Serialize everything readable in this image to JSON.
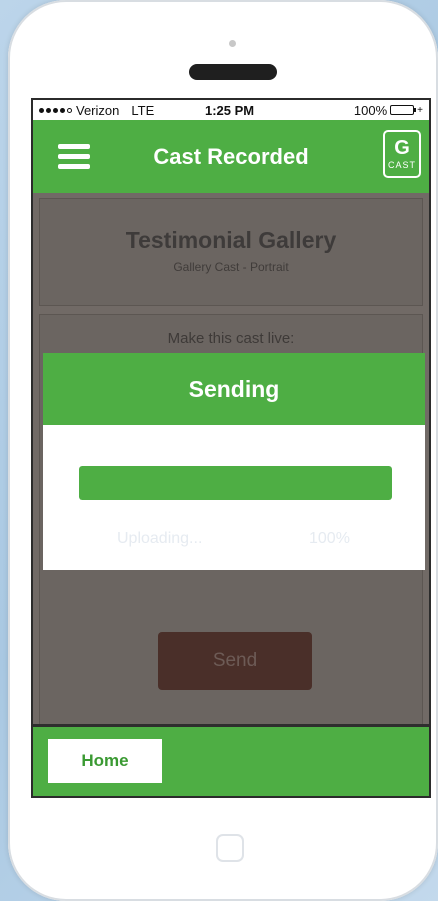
{
  "status_bar": {
    "carrier": "Verizon",
    "network": "LTE",
    "time": "1:25 PM",
    "battery": "100%"
  },
  "nav": {
    "title": "Cast Recorded",
    "logo_text": "CAST"
  },
  "gallery": {
    "title": "Testimonial Gallery",
    "subtitle": "Gallery Cast - Portrait",
    "prompt": "Make this cast live:"
  },
  "send_button": "Send",
  "modal": {
    "title": "Sending",
    "status_label": "Uploading...",
    "percent_text": "100%",
    "progress": 1.0
  },
  "footer": {
    "home_label": "Home"
  },
  "colors": {
    "accent": "#4eae44",
    "overlay": "#6b6561",
    "send_button": "#4a2f29"
  },
  "icons": [
    "menu-icon",
    "cast-logo-icon",
    "battery-icon",
    "signal-icon"
  ]
}
